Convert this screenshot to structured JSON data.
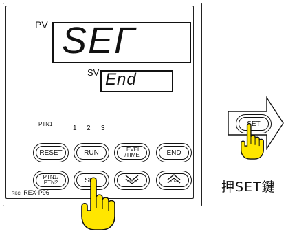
{
  "display": {
    "pv_label": "PV",
    "pv_value": "SEГ",
    "sv_label": "SV",
    "sv_value": "End"
  },
  "pattern": {
    "label": "PTN1",
    "numbers": [
      "1",
      "2",
      "3"
    ]
  },
  "buttons": {
    "reset": "RESET",
    "run": "RUN",
    "level_time": "LEVEL\n/TIME",
    "end": "END",
    "ptn": "PTN1/\nPTN2",
    "set": "SET",
    "hold_sub": "HOLD",
    "step_sub": "STEP"
  },
  "brand": {
    "mark": "RKC",
    "model": "REX-P96"
  },
  "side": {
    "set_label": "SET",
    "caption": "押SET鍵"
  },
  "colors": {
    "hand_fill": "#ffe600",
    "line": "#111111"
  },
  "icons": {
    "down": "double-chevron-down-icon",
    "up": "double-chevron-up-icon",
    "hand": "pointing-hand-icon",
    "arrow": "right-arrow-icon"
  }
}
